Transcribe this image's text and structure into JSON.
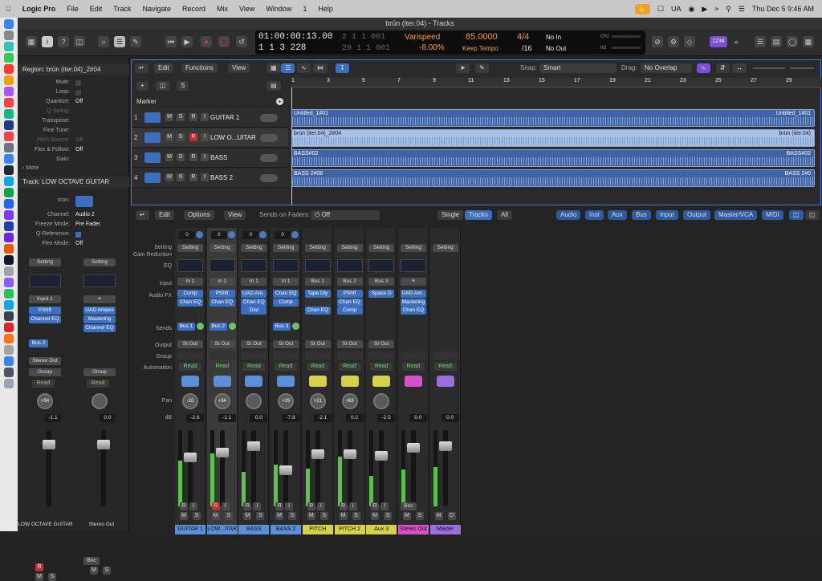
{
  "menubar": {
    "app": "Logic Pro",
    "items": [
      "File",
      "Edit",
      "Track",
      "Navigate",
      "Record",
      "Mix",
      "View",
      "Window",
      "1",
      "Help"
    ],
    "status": [
      "UA",
      "Thu Dec 5  9:46 AM"
    ]
  },
  "window": {
    "title": "brün (iter.04) - Tracks"
  },
  "lcd": {
    "time": "01:00:00:13.00",
    "bars_top": "2  1  1  001",
    "bars": "1  1  3  228",
    "bars_small": "29  1  1  001",
    "varispeed": "Varispeed",
    "vari_val": "-8.00%",
    "tempo": "85.0000",
    "keep": "Keep Tempo",
    "sig_top": "4/4",
    "sig_bot": "/16",
    "in": "No In",
    "out": "No Out",
    "cpu": "CPU",
    "hd": "HD",
    "badge": "1234"
  },
  "inspector": {
    "region": "Region: brün (iter.04)_2#04",
    "rows": [
      [
        "Mute:",
        ""
      ],
      [
        "Loop:",
        ""
      ],
      [
        "Quantize:",
        "Off"
      ],
      [
        "Q-Swing:",
        ""
      ],
      [
        "Transpose:",
        ""
      ],
      [
        "Fine Tune:",
        ""
      ],
      [
        "Pitch Source:",
        "Off"
      ],
      [
        "Flex & Follow:",
        "Off"
      ],
      [
        "Gain:",
        ""
      ]
    ],
    "more": "More",
    "track": "Track:  LOW OCTAVE GUITAR",
    "trows": [
      [
        "Icon:",
        ""
      ],
      [
        "Channel:",
        "Audio 2"
      ],
      [
        "Freeze Mode:",
        "Pre Fader"
      ],
      [
        "Q-Reference:",
        ""
      ],
      [
        "Flex Mode:",
        "Off"
      ]
    ],
    "strips": [
      {
        "setting": "Setting",
        "input": "Input 1",
        "fx1": "PShft",
        "fx2": "Channel EQ",
        "send": "Bus 2",
        "out": "Stereo Out",
        "group": "Group",
        "auto": "Read",
        "pan": "+34",
        "db": "-1.1",
        "name": "LOW OCTAVE GUITAR"
      },
      {
        "setting": "Setting",
        "input": "",
        "fx1": "UAD Ampex",
        "fx2": "Mastering",
        "fx3": "Channel EQ",
        "send": "",
        "out": "",
        "group": "Group",
        "auto": "Read",
        "pan": "",
        "db": "0.0",
        "bnc": "Bnc",
        "name": "Stereo Out"
      }
    ]
  },
  "tracks": {
    "menus": [
      "Edit",
      "Functions",
      "View"
    ],
    "snap_label": "Snap:",
    "snap": "Smart",
    "drag_label": "Drag:",
    "drag": "No Overlap",
    "marker": "Marker",
    "ruler": [
      "1",
      "3",
      "5",
      "7",
      "9",
      "11",
      "13",
      "15",
      "17",
      "19",
      "21",
      "23",
      "25",
      "27",
      "29"
    ],
    "list": [
      {
        "n": "1",
        "name": "GUITAR 1",
        "region": "Untitled_1#01",
        "rend": "Untitled_1#01"
      },
      {
        "n": "2",
        "name": "LOW O...UITAR",
        "region": "brün (iter.04)_2#04",
        "rend": "brün (iter.04)"
      },
      {
        "n": "3",
        "name": "BASS",
        "region": "BASS#02",
        "rend": "BASS#02"
      },
      {
        "n": "4",
        "name": "BASS 2",
        "region": "BASS 2#08",
        "rend": "BASS 2#0"
      }
    ]
  },
  "mixer": {
    "menus": [
      "Edit",
      "Options",
      "View"
    ],
    "sends_label": "Sends on Faders:",
    "sends_val": "Off",
    "views": [
      "Single",
      "Tracks",
      "All"
    ],
    "filters": [
      "Audio",
      "Inst",
      "Aux",
      "Bus",
      "Input",
      "Output",
      "Master/VCA",
      "MIDI"
    ],
    "labels": [
      "Setting",
      "Gain Reduction",
      "EQ",
      "Input",
      "Audio FX",
      "Sends",
      "Output",
      "Group",
      "Automation",
      "Pan",
      "dB"
    ],
    "strips": [
      {
        "name": "GUITAR 1",
        "num": "0",
        "input": "In 1",
        "fx": [
          "Comp",
          "Chan EQ"
        ],
        "send": "Bus 1",
        "out": "St Out",
        "auto": "Read",
        "pan": "-10",
        "db": "-2.6",
        "color": "#5b8fd8"
      },
      {
        "name": "LOW...ITAR",
        "num": "0",
        "input": "In 1",
        "fx": [
          "PShft",
          "Chan EQ"
        ],
        "send": "Bus 2",
        "out": "St Out",
        "auto": "Read",
        "pan": "+34",
        "db": "-1.1",
        "color": "#5b8fd8"
      },
      {
        "name": "BASS",
        "num": "0",
        "input": "In 1",
        "fx": [
          "UAD Am..",
          "Chan EQ",
          "Dist"
        ],
        "send": "",
        "out": "St Out",
        "auto": "Read",
        "pan": "",
        "db": "0.0",
        "color": "#5b8fd8"
      },
      {
        "name": "BASS 2",
        "num": "0",
        "input": "In 1",
        "fx": [
          "Chan EQ",
          "Comp"
        ],
        "send": "Bus 3",
        "out": "St Out",
        "auto": "Read",
        "pan": "+29",
        "db": "-7.8",
        "color": "#5b8fd8"
      },
      {
        "name": "PITCH",
        "num": "",
        "input": "Bus 1",
        "fx": [
          "Tape Dly",
          "",
          "Chan EQ"
        ],
        "send": "",
        "out": "St Out",
        "auto": "Read",
        "pan": "+21",
        "db": "-2.1",
        "color": "#d7d04a"
      },
      {
        "name": "PITCH 2",
        "num": "",
        "input": "Bus 2",
        "fx": [
          "PShft",
          "Chan EQ",
          "Comp"
        ],
        "send": "",
        "out": "St Out",
        "auto": "Read",
        "pan": "+63",
        "db": "0.2",
        "color": "#d7d04a"
      },
      {
        "name": "Aux 3",
        "num": "",
        "input": "Bus 3",
        "fx": [
          "Space D"
        ],
        "send": "",
        "out": "St Out",
        "auto": "Read",
        "pan": "",
        "db": "-2.5",
        "color": "#d7d04a"
      },
      {
        "name": "Stereo Out",
        "num": "",
        "input": "",
        "fx": [
          "UAD Am..",
          "Mastering",
          "Chan EQ"
        ],
        "send": "",
        "out": "",
        "auto": "Read",
        "pan": "",
        "db": "0.0",
        "bnc": "Bnc",
        "color": "#d752c9"
      },
      {
        "name": "Master",
        "num": "",
        "input": "",
        "fx": [],
        "send": "",
        "out": "",
        "auto": "Read",
        "pan": "",
        "db": "0.0",
        "color": "#9d6de0"
      }
    ],
    "common": {
      "setting": "Setting",
      "m": "M",
      "s": "S",
      "d": "D",
      "r": "R",
      "i": "I"
    }
  },
  "colors": {
    "accent": "#3d6fbf",
    "yellow": "#d7d04a",
    "pink": "#d752c9",
    "purple": "#9d6de0",
    "orange": "#f0a030"
  }
}
